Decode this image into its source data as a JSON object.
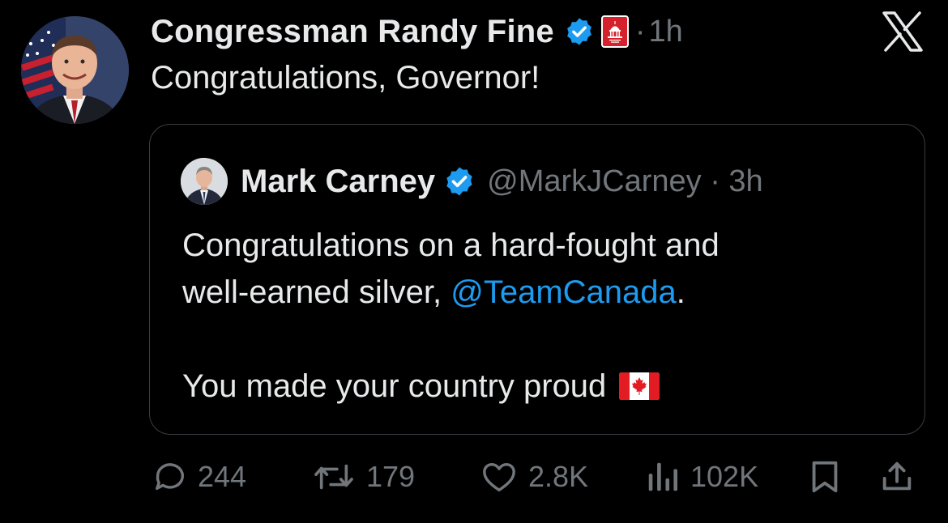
{
  "post": {
    "author_name": "Congressman Randy Fine",
    "time": "1h",
    "separator": "·",
    "text": "Congratulations, Governor!"
  },
  "quoted": {
    "author_name": "Mark Carney",
    "handle_time": "@MarkJCarney · 3h",
    "line1": "Congratulations on a hard-fought and",
    "line2_prefix": "well-earned silver, ",
    "mention": "@TeamCanada",
    "line2_suffix": ".",
    "line3": "You made your country proud"
  },
  "actions": {
    "replies": "244",
    "reposts": "179",
    "likes": "2.8K",
    "views": "102K"
  },
  "icons": {
    "close": "x-logo-icon",
    "verified": "verified-badge-icon",
    "affiliation": "capitol-badge-icon",
    "reply": "reply-icon",
    "repost": "repost-icon",
    "like": "heart-icon",
    "views": "views-chart-icon",
    "bookmark": "bookmark-icon",
    "share": "share-icon",
    "flag": "canada-flag-icon"
  },
  "colors": {
    "background": "#000000",
    "text": "#e7e9ea",
    "muted": "#71767b",
    "link": "#1d9bf0",
    "verified": "#1d9bf0",
    "border": "#3a3d42"
  }
}
